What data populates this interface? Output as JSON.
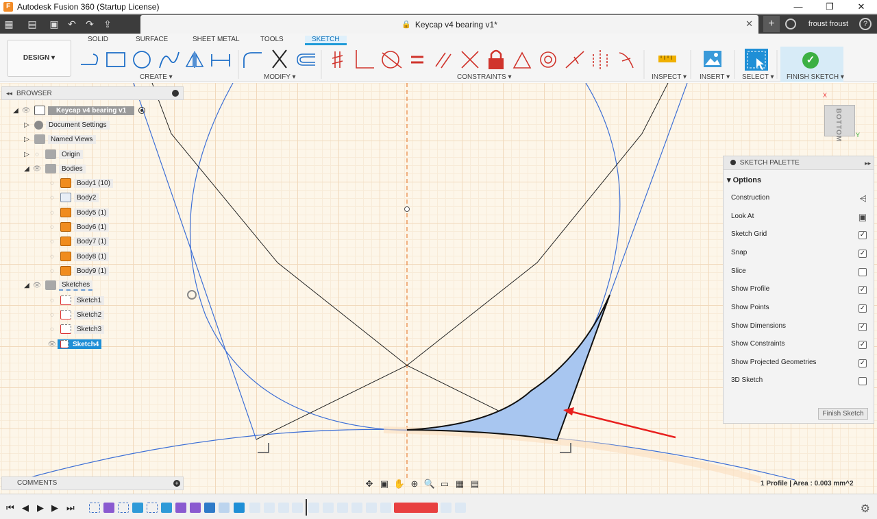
{
  "window": {
    "title": "Autodesk Fusion 360 (Startup License)",
    "logo_letter": "F",
    "controls": [
      "—",
      "❐",
      "✕"
    ]
  },
  "quick_access": {
    "icons": [
      "grid-icon",
      "file-icon",
      "save-icon",
      "undo-icon",
      "redo-icon",
      "export-icon"
    ],
    "doc_tab_title": "Keycap v4 bearing v1*",
    "new_tab": "+",
    "user_name": "froust froust",
    "help": "?"
  },
  "toolbar": {
    "workspace_button": "DESIGN ▾",
    "tabs": [
      {
        "label": "SOLID",
        "active": false
      },
      {
        "label": "SURFACE",
        "active": false
      },
      {
        "label": "SHEET METAL",
        "active": false
      },
      {
        "label": "TOOLS",
        "active": false
      },
      {
        "label": "SKETCH",
        "active": true
      }
    ],
    "groups": {
      "create": "CREATE ▾",
      "modify": "MODIFY ▾",
      "constraints": "CONSTRAINTS ▾",
      "inspect": "INSPECT ▾",
      "insert": "INSERT ▾",
      "select": "SELECT ▾",
      "finish": "FINISH SKETCH ▾"
    }
  },
  "browser": {
    "header": "BROWSER",
    "root": "Keycap v4 bearing v1",
    "items": [
      {
        "label": "Document Settings",
        "icon": "gear-icon"
      },
      {
        "label": "Named Views",
        "icon": "folder-icon"
      },
      {
        "label": "Origin",
        "icon": "folder-icon"
      },
      {
        "label": "Bodies",
        "icon": "folder-icon"
      }
    ],
    "bodies": [
      "Body1 (10)",
      "Body2",
      "Body5 (1)",
      "Body6 (1)",
      "Body7 (1)",
      "Body8 (1)",
      "Body9 (1)"
    ],
    "sketches_folder": "Sketches",
    "sketches": [
      "Sketch1",
      "Sketch2",
      "Sketch3",
      "Sketch4"
    ],
    "active_sketch": "Sketch4"
  },
  "comments": {
    "label": "COMMENTS"
  },
  "sketch_palette": {
    "header": "SKETCH PALETTE",
    "section": "Options",
    "options": [
      {
        "label": "Construction",
        "type": "icon",
        "icon": "construction-icon"
      },
      {
        "label": "Look At",
        "type": "icon",
        "icon": "look-at-icon"
      },
      {
        "label": "Sketch Grid",
        "type": "checkbox",
        "checked": true
      },
      {
        "label": "Snap",
        "type": "checkbox",
        "checked": true
      },
      {
        "label": "Slice",
        "type": "checkbox",
        "checked": false
      },
      {
        "label": "Show Profile",
        "type": "checkbox",
        "checked": true
      },
      {
        "label": "Show Points",
        "type": "checkbox",
        "checked": true
      },
      {
        "label": "Show Dimensions",
        "type": "checkbox",
        "checked": true
      },
      {
        "label": "Show Constraints",
        "type": "checkbox",
        "checked": true
      },
      {
        "label": "Show Projected Geometries",
        "type": "checkbox",
        "checked": true
      },
      {
        "label": "3D Sketch",
        "type": "checkbox",
        "checked": false
      }
    ],
    "finish_button": "Finish Sketch"
  },
  "viewcube": {
    "face": "BOTTOM",
    "axis_x": "X",
    "axis_y": "Y"
  },
  "status": {
    "profile_info": "1 Profile | Area : 0.003 mm^2"
  },
  "colors": {
    "accent": "#1f9ad8",
    "profile_fill": "#a8c6f0",
    "sketch_line_blue": "#3d6fd6",
    "construction_orange": "#e8823a",
    "arrow_red": "#e8201e",
    "body_orange": "#f08c1e"
  }
}
